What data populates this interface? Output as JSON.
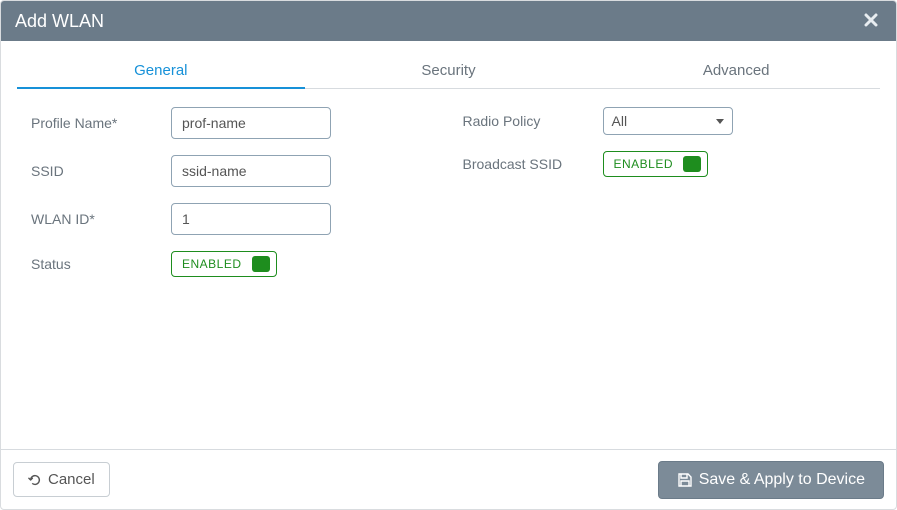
{
  "title": "Add WLAN",
  "tabs": [
    {
      "label": "General",
      "active": true
    },
    {
      "label": "Security",
      "active": false
    },
    {
      "label": "Advanced",
      "active": false
    }
  ],
  "left_fields": {
    "profile_name": {
      "label": "Profile Name*",
      "value": "prof-name"
    },
    "ssid": {
      "label": "SSID",
      "value": "ssid-name"
    },
    "wlan_id": {
      "label": "WLAN ID*",
      "value": "1"
    },
    "status": {
      "label": "Status",
      "state_text": "ENABLED"
    }
  },
  "right_fields": {
    "radio_policy": {
      "label": "Radio Policy",
      "selected": "All"
    },
    "broadcast_ssid": {
      "label": "Broadcast SSID",
      "state_text": "ENABLED"
    }
  },
  "footer": {
    "cancel_label": "Cancel",
    "save_label": "Save & Apply to Device"
  }
}
